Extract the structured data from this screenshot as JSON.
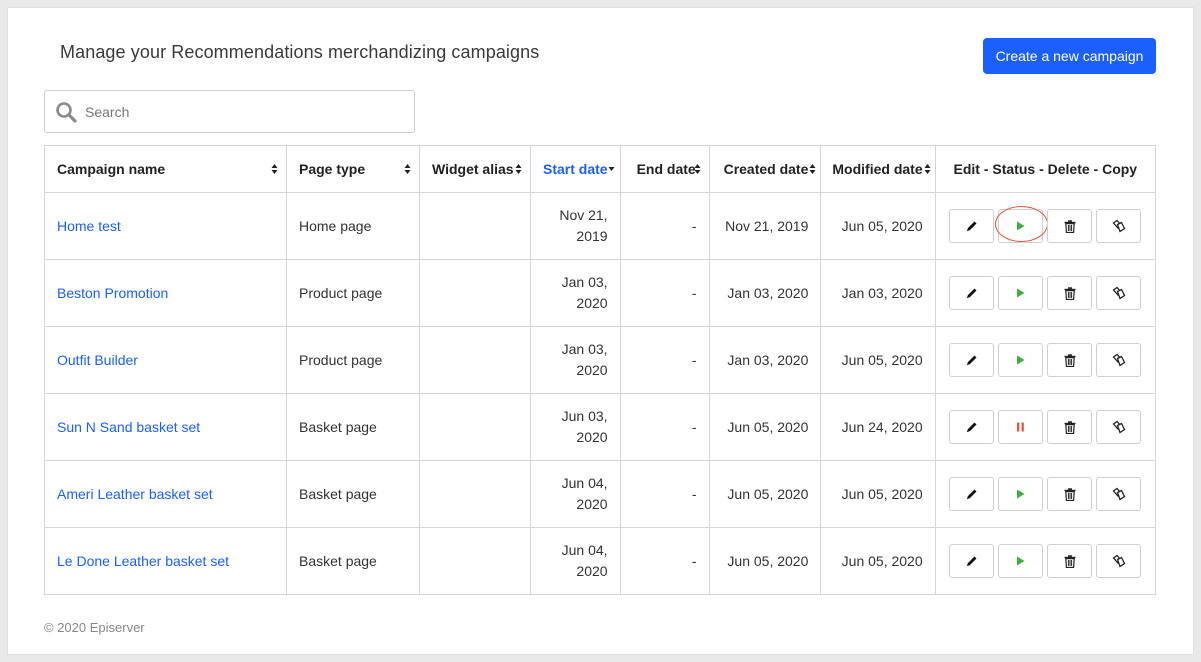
{
  "header": {
    "title": "Manage your Recommendations merchandizing campaigns",
    "create_button": "Create a new campaign"
  },
  "search": {
    "placeholder": "Search",
    "value": ""
  },
  "table": {
    "columns": [
      {
        "label": "Campaign name",
        "sortable": true
      },
      {
        "label": "Page type",
        "sortable": true
      },
      {
        "label": "Widget alias",
        "sortable": true
      },
      {
        "label": "Start date",
        "sortable": true,
        "active": true
      },
      {
        "label": "End date",
        "sortable": true
      },
      {
        "label": "Created date",
        "sortable": true
      },
      {
        "label": "Modified date",
        "sortable": true
      },
      {
        "label": "Edit - Status - Delete - Copy",
        "sortable": false
      }
    ],
    "rows": [
      {
        "name": "Home test",
        "page_type": "Home page",
        "widget_alias": "",
        "start_date_line1": "Nov 21,",
        "start_date_line2": "2019",
        "end_date": "-",
        "created_date": "Nov 21, 2019",
        "modified_date": "Jun 05, 2020",
        "status": "play"
      },
      {
        "name": "Beston Promotion",
        "page_type": "Product page",
        "widget_alias": "",
        "start_date_line1": "Jan 03,",
        "start_date_line2": "2020",
        "end_date": "-",
        "created_date": "Jan 03, 2020",
        "modified_date": "Jan 03, 2020",
        "status": "play"
      },
      {
        "name": "Outfit Builder",
        "page_type": "Product page",
        "widget_alias": "",
        "start_date_line1": "Jan 03,",
        "start_date_line2": "2020",
        "end_date": "-",
        "created_date": "Jan 03, 2020",
        "modified_date": "Jun 05, 2020",
        "status": "play"
      },
      {
        "name": "Sun N Sand basket set",
        "page_type": "Basket page",
        "widget_alias": "",
        "start_date_line1": "Jun 03,",
        "start_date_line2": "2020",
        "end_date": "-",
        "created_date": "Jun 05, 2020",
        "modified_date": "Jun 24, 2020",
        "status": "pause"
      },
      {
        "name": "Ameri Leather basket set",
        "page_type": "Basket page",
        "widget_alias": "",
        "start_date_line1": "Jun 04,",
        "start_date_line2": "2020",
        "end_date": "-",
        "created_date": "Jun 05, 2020",
        "modified_date": "Jun 05, 2020",
        "status": "play"
      },
      {
        "name": "Le Done Leather basket set",
        "page_type": "Basket page",
        "widget_alias": "",
        "start_date_line1": "Jun 04,",
        "start_date_line2": "2020",
        "end_date": "-",
        "created_date": "Jun 05, 2020",
        "modified_date": "Jun 05, 2020",
        "status": "play"
      }
    ]
  },
  "footer": {
    "copyright": "© 2020 Episerver"
  },
  "colors": {
    "accent": "#1b5fff",
    "play": "#3fae3b",
    "pause": "#e8503a",
    "highlight": "#e8503a"
  },
  "icons": {
    "edit": "pencil-icon",
    "play": "play-icon",
    "pause": "pause-icon",
    "delete": "trash-icon",
    "copy": "copy-icon",
    "search": "search-icon"
  }
}
